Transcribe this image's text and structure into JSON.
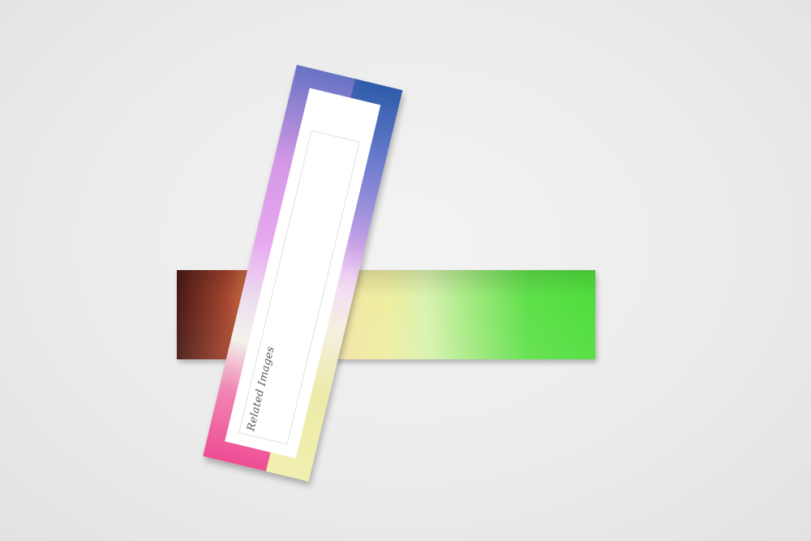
{
  "panel": {
    "label": "Related Images"
  },
  "colors": {
    "wall": "#ececec",
    "bar_left": "#4a1a16",
    "bar_right": "#4fde3c",
    "tilted_top": "#3a69b5",
    "tilted_bottom": "#ee2f8e"
  }
}
